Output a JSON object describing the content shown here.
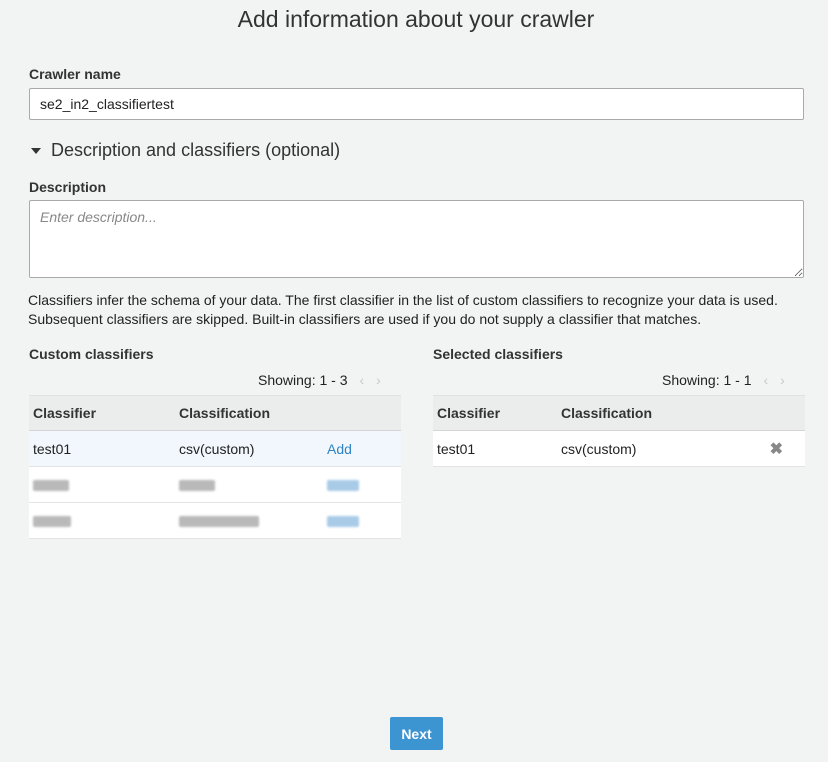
{
  "header": {
    "title": "Add information about your crawler"
  },
  "crawler_name": {
    "label": "Crawler name",
    "value": "se2_in2_classifiertest"
  },
  "description_section": {
    "toggle_label": "Description and classifiers (optional)",
    "description_label": "Description",
    "description_placeholder": "Enter description...",
    "help_text": "Classifiers infer the schema of your data. The first classifier in the list of custom classifiers to recognize your data is used. Subsequent classifiers are skipped. Built-in classifiers are used if you do not supply a classifier that matches."
  },
  "custom_classifiers": {
    "title": "Custom classifiers",
    "showing": "Showing: 1 - 3",
    "columns": [
      "Classifier",
      "Classification"
    ],
    "rows": [
      {
        "classifier": "test01",
        "classification": "csv(custom)",
        "action": "Add"
      }
    ]
  },
  "selected_classifiers": {
    "title": "Selected classifiers",
    "showing": "Showing: 1 - 1",
    "columns": [
      "Classifier",
      "Classification"
    ],
    "rows": [
      {
        "classifier": "test01",
        "classification": "csv(custom)"
      }
    ]
  },
  "icons": {
    "caret": "caret-down-icon",
    "prev": "chevron-left-icon",
    "next": "chevron-right-icon",
    "remove": "close-icon"
  },
  "colors": {
    "primary": "#3c94d1",
    "link": "#2e84c3",
    "background": "#f2f3f3"
  },
  "footer": {
    "next_label": "Next"
  }
}
